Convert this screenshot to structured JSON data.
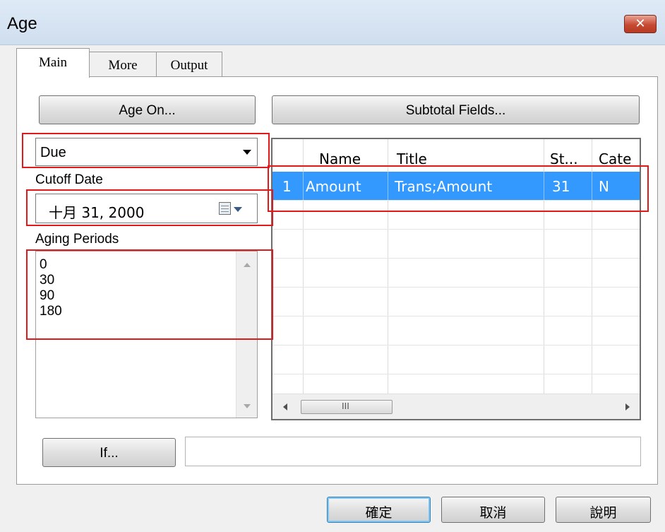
{
  "window": {
    "title": "Age",
    "close_glyph": "✕"
  },
  "tabs": [
    {
      "label": "Main",
      "active": true
    },
    {
      "label": "More",
      "active": false
    },
    {
      "label": "Output",
      "active": false
    }
  ],
  "buttons": {
    "age_on": "Age On...",
    "subtotal_fields": "Subtotal Fields...",
    "if": "If..."
  },
  "age_type": {
    "selected": "Due"
  },
  "cutoff": {
    "label": "Cutoff Date",
    "value": "十月  31, 2000"
  },
  "aging": {
    "label": "Aging Periods",
    "periods": [
      "0",
      "30",
      "90",
      "180"
    ]
  },
  "subtotal_grid": {
    "columns": [
      "",
      "Name",
      "Title",
      "St...",
      "Cate"
    ],
    "rows": [
      {
        "num": "1",
        "name": "Amount",
        "title": "Trans;Amount",
        "st": "31",
        "cate": "N",
        "selected": true
      }
    ],
    "scroll_grip": "III"
  },
  "if_expression": {
    "value": ""
  },
  "dialog_buttons": {
    "ok": "確定",
    "cancel": "取消",
    "help": "說明"
  },
  "colors": {
    "selection": "#3399ff",
    "annotation": "#e01a1a"
  }
}
